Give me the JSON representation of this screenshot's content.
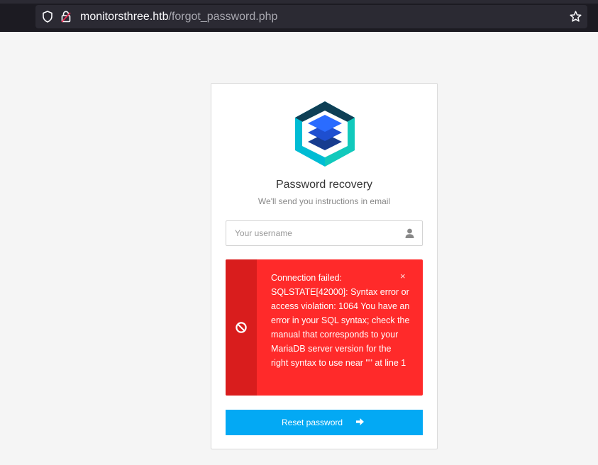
{
  "browser": {
    "url_host": "monitorsthree.htb",
    "url_path": "/forgot_password.php",
    "icons": [
      "shield-icon",
      "lock-icon",
      "bookmark-star-icon"
    ]
  },
  "card": {
    "title": "Password recovery",
    "subtitle": "We'll send you instructions in email",
    "username": {
      "placeholder": "Your username",
      "value": "",
      "icon": "user-icon"
    },
    "alert": {
      "icon": "ban-icon",
      "message": "Connection failed: SQLSTATE[42000]: Syntax error or access violation: 1064 You have an error in your SQL syntax; check the manual that corresponds to your MariaDB server version for the right syntax to use near '''' at line 1",
      "close_label": "×"
    },
    "submit_label": "Reset password",
    "submit_icon": "arrow-right-icon"
  },
  "colors": {
    "page_bg": "#f5f5f5",
    "alert_bg": "#ff2a2a",
    "alert_bar": "#d91d1d",
    "button_bg": "#03a9f4",
    "logo_outer": "#00bcd4",
    "logo_mid": "#1e4fd0",
    "logo_core": "#2a6cff"
  }
}
